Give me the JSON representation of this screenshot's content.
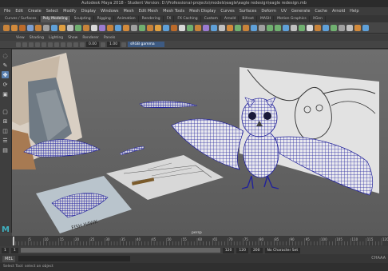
{
  "window": {
    "title": "Autodesk Maya 2018 - Student Version: D:\\Professional-projects\\models\\eagle\\eagle redesign\\eagle redesign.mb"
  },
  "menubar": {
    "items": [
      "File",
      "Edit",
      "Create",
      "Select",
      "Modify",
      "Display",
      "Windows",
      "Mesh",
      "Edit Mesh",
      "Mesh Tools",
      "Mesh Display",
      "Curves",
      "Surfaces",
      "Deform",
      "UV",
      "Generate",
      "Cache",
      "Arnold",
      "Help"
    ]
  },
  "shelf": {
    "tabs": [
      "Curves / Surfaces",
      "Poly Modeling",
      "Sculpting",
      "Rigging",
      "Animation",
      "Rendering",
      "FX",
      "FX Caching",
      "Custom",
      "Arnold",
      "Bifrost",
      "MASH",
      "Motion Graphics",
      "XGen"
    ],
    "active_tab": 1
  },
  "panel": {
    "menus": [
      "View",
      "Shading",
      "Lighting",
      "Show",
      "Renderer",
      "Panels"
    ],
    "field_value": "0.00",
    "field_scale": "1.00",
    "color_space": "sRGB gamma"
  },
  "viewport": {
    "label": "persp"
  },
  "timeline": {
    "ticks": [
      "5",
      "10",
      "15",
      "20",
      "25",
      "30",
      "35",
      "40",
      "45",
      "50",
      "55",
      "60",
      "65",
      "70",
      "75",
      "80",
      "85",
      "90",
      "95",
      "100",
      "105",
      "110",
      "115",
      "120"
    ],
    "current_frame": "1"
  },
  "range": {
    "start": "1",
    "start_inner": "1",
    "slider_value": "120",
    "end_inner": "120",
    "end": "200",
    "anim_layer": "No Character Set"
  },
  "command": {
    "mode": "MEL"
  },
  "helpline": {
    "text": "Select Tool: select an object"
  },
  "watermark": {
    "text": "CHAAA"
  },
  "paper": {
    "stamp": "FISH HAWK"
  },
  "colors": {
    "accent": "#5a80b0",
    "wire": "#2b2ba0",
    "logo": "#3fb0c0"
  }
}
